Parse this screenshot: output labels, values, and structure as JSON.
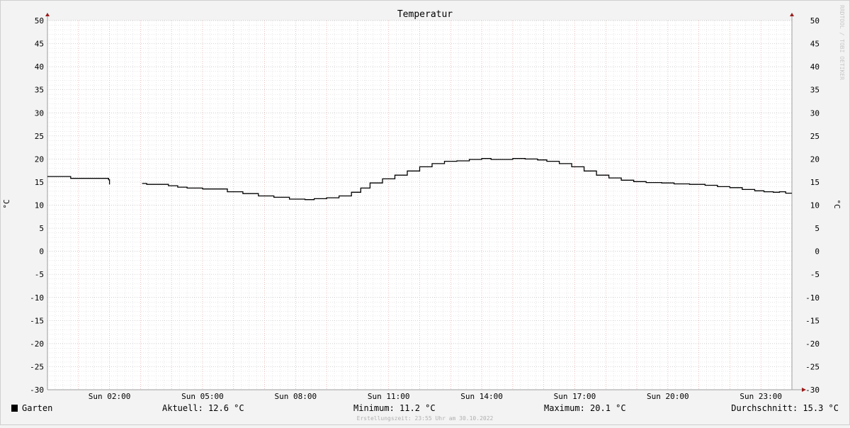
{
  "chart_data": {
    "type": "line",
    "title": "Temperatur",
    "ylabel": "°C",
    "ylabel_right": "°C",
    "ylim": [
      -30,
      50
    ],
    "yticks": [
      50,
      45,
      40,
      35,
      30,
      25,
      20,
      15,
      10,
      5,
      0,
      -5,
      -10,
      -15,
      -20,
      -25,
      -30
    ],
    "xlim": [
      0,
      24
    ],
    "xticks": [
      {
        "x": 2,
        "label": "Sun 02:00"
      },
      {
        "x": 5,
        "label": "Sun 05:00"
      },
      {
        "x": 8,
        "label": "Sun 08:00"
      },
      {
        "x": 11,
        "label": "Sun 11:00"
      },
      {
        "x": 14,
        "label": "Sun 14:00"
      },
      {
        "x": 17,
        "label": "Sun 17:00"
      },
      {
        "x": 20,
        "label": "Sun 20:00"
      },
      {
        "x": 23,
        "label": "Sun 23:00"
      }
    ],
    "grid": true,
    "series": [
      {
        "name": "Garten",
        "color": "#000000",
        "segments": [
          [
            [
              0,
              16.2
            ],
            [
              0.3,
              16.2
            ],
            [
              0.65,
              16.2
            ],
            [
              0.75,
              15.8
            ],
            [
              1.0,
              15.8
            ],
            [
              1.5,
              15.8
            ],
            [
              1.9,
              15.8
            ],
            [
              1.97,
              15.5
            ],
            [
              2.0,
              14.5
            ]
          ],
          [
            [
              3.05,
              14.7
            ],
            [
              3.2,
              14.5
            ],
            [
              3.7,
              14.5
            ],
            [
              3.9,
              14.2
            ],
            [
              4.2,
              13.9
            ],
            [
              4.5,
              13.7
            ],
            [
              5.0,
              13.5
            ],
            [
              5.4,
              13.5
            ],
            [
              5.8,
              12.9
            ],
            [
              6.3,
              12.5
            ],
            [
              6.8,
              12.0
            ],
            [
              7.3,
              11.7
            ],
            [
              7.8,
              11.3
            ],
            [
              8.3,
              11.2
            ],
            [
              8.6,
              11.4
            ],
            [
              9.0,
              11.6
            ],
            [
              9.4,
              12.0
            ],
            [
              9.8,
              12.8
            ],
            [
              10.1,
              13.7
            ],
            [
              10.4,
              14.8
            ],
            [
              10.8,
              15.7
            ],
            [
              11.2,
              16.5
            ],
            [
              11.6,
              17.4
            ],
            [
              12.0,
              18.3
            ],
            [
              12.4,
              19.0
            ],
            [
              12.8,
              19.5
            ],
            [
              13.2,
              19.6
            ],
            [
              13.6,
              19.9
            ],
            [
              14.0,
              20.1
            ],
            [
              14.3,
              19.9
            ],
            [
              14.6,
              19.9
            ],
            [
              15.0,
              20.1
            ],
            [
              15.4,
              20.0
            ],
            [
              15.8,
              19.8
            ],
            [
              16.1,
              19.5
            ],
            [
              16.5,
              19.0
            ],
            [
              16.9,
              18.3
            ],
            [
              17.3,
              17.4
            ],
            [
              17.7,
              16.5
            ],
            [
              18.1,
              15.9
            ],
            [
              18.5,
              15.4
            ],
            [
              18.9,
              15.1
            ],
            [
              19.3,
              14.9
            ],
            [
              19.8,
              14.8
            ],
            [
              20.2,
              14.6
            ],
            [
              20.7,
              14.5
            ],
            [
              21.2,
              14.3
            ],
            [
              21.6,
              14.0
            ],
            [
              22.0,
              13.8
            ],
            [
              22.4,
              13.4
            ],
            [
              22.8,
              13.1
            ],
            [
              23.1,
              12.9
            ],
            [
              23.4,
              12.8
            ],
            [
              23.6,
              12.9
            ],
            [
              23.8,
              12.6
            ],
            [
              24.0,
              12.6
            ]
          ]
        ]
      }
    ],
    "legend": {
      "label": "Garten",
      "color": "#000000",
      "current": "Aktuell: 12.6 °C",
      "minimum": "Minimum: 11.2 °C",
      "maximum": "Maximum: 20.1 °C",
      "average": "Durchschnitt: 15.3 °C"
    },
    "watermark": "RRDTOOL / TOBI OETIKER",
    "created": "Erstellungszeit: 23:55 Uhr am 30.10.2022"
  }
}
